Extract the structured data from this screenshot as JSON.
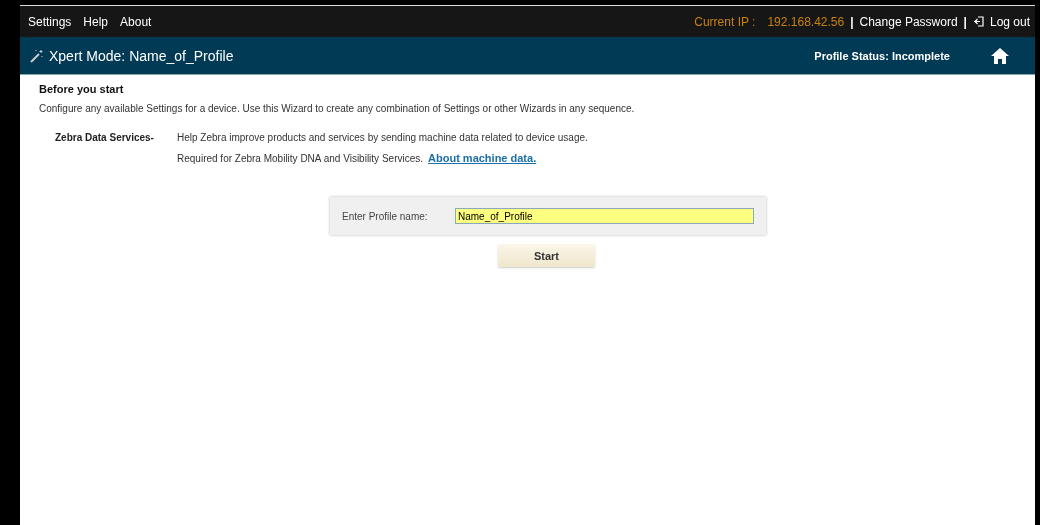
{
  "menu": [
    "Settings",
    "Help",
    "About"
  ],
  "top_right": {
    "ip_label": "Current IP :",
    "ip": "192.168.42.56",
    "separator": "|",
    "change_password": "Change Password",
    "separator_2": "|",
    "logout": "Log out"
  },
  "header": {
    "title": "Xpert Mode: Name_of_Profile",
    "status": "Profile Status: Incomplete"
  },
  "intro": {
    "heading": "Before you start",
    "text": "Configure any available Settings for a device. Use this Wizard to create any combination of Settings or other Wizards in any sequence."
  },
  "data_services": {
    "label": "Zebra Data Services-",
    "line_1": "Help Zebra improve products and services by sending machine data related to device usage.",
    "line_2": "Required for Zebra Mobility DNA and Visibility Services.",
    "link": "About machine data."
  },
  "profile_form": {
    "label": "Enter Profile name:",
    "value": "Name_of_Profile",
    "button": "Start"
  }
}
